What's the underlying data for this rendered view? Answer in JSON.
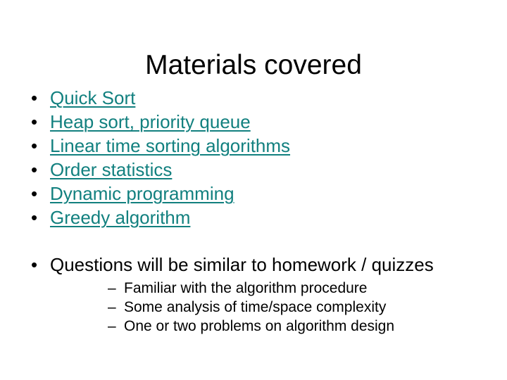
{
  "slide": {
    "title": "Materials covered",
    "topics": [
      {
        "label": "Quick Sort",
        "bullet": "•",
        "style": "link"
      },
      {
        "label": "Heap sort, priority queue",
        "bullet": "•",
        "style": "link"
      },
      {
        "label": "Linear time sorting algorithms",
        "bullet": "•",
        "style": "link"
      },
      {
        "label": "Order statistics",
        "bullet": "•",
        "style": "link"
      },
      {
        "label": "Dynamic programming",
        "bullet": "•",
        "style": "link"
      },
      {
        "label": "Greedy algorithm",
        "bullet": "•",
        "style": "link"
      }
    ],
    "questions": {
      "bullet": "•",
      "label": "Questions will be similar to homework / quizzes",
      "sub_bullet": "–",
      "sub_items": [
        "Familiar with the algorithm procedure",
        "Some analysis of time/space complexity",
        "One or two problems on algorithm design"
      ]
    },
    "colors": {
      "background": "#ffffff",
      "title_text": "#000000",
      "link_text": "#12807f",
      "body_text": "#000000"
    }
  }
}
